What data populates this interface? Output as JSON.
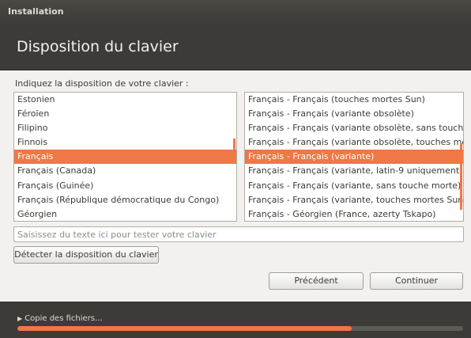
{
  "window": {
    "title": "Installation"
  },
  "page": {
    "title": "Disposition du clavier"
  },
  "prompt": "Indiquez la disposition de votre clavier :",
  "layouts": {
    "items": [
      "Estonien",
      "Féroïen",
      "Filipino",
      "Finnois",
      "Français",
      "Français (Canada)",
      "Français (Guinée)",
      "Français (République démocratique du Congo)",
      "Géorgien"
    ],
    "selected_index": 4
  },
  "variants": {
    "items": [
      "Français - Français (touches mortes Sun)",
      "Français - Français (variante obsolète)",
      "Français - Français (variante obsolète, sans touche morte)",
      "Français - Français (variante obsolète, touches mortes Sun)",
      "Français - Français (variante)",
      "Français - Français (variante, latin-9 uniquement)",
      "Français - Français (variante, sans touche morte)",
      "Français - Français (variante, touches mortes Sun)",
      "Français - Géorgien (France, azerty Tskapo)"
    ],
    "selected_index": 4
  },
  "test_input": {
    "placeholder": "Saisissez du texte ici pour tester votre clavier",
    "value": ""
  },
  "buttons": {
    "detect": "Détecter la disposition du clavier",
    "previous": "Précédent",
    "next": "Continuer"
  },
  "footer": {
    "status": "Copie des fichiers...",
    "progress": 0.75
  },
  "colors": {
    "accent": "#f07746",
    "header_bg": "#3c3b37",
    "window_bg": "#f2f1f0"
  }
}
